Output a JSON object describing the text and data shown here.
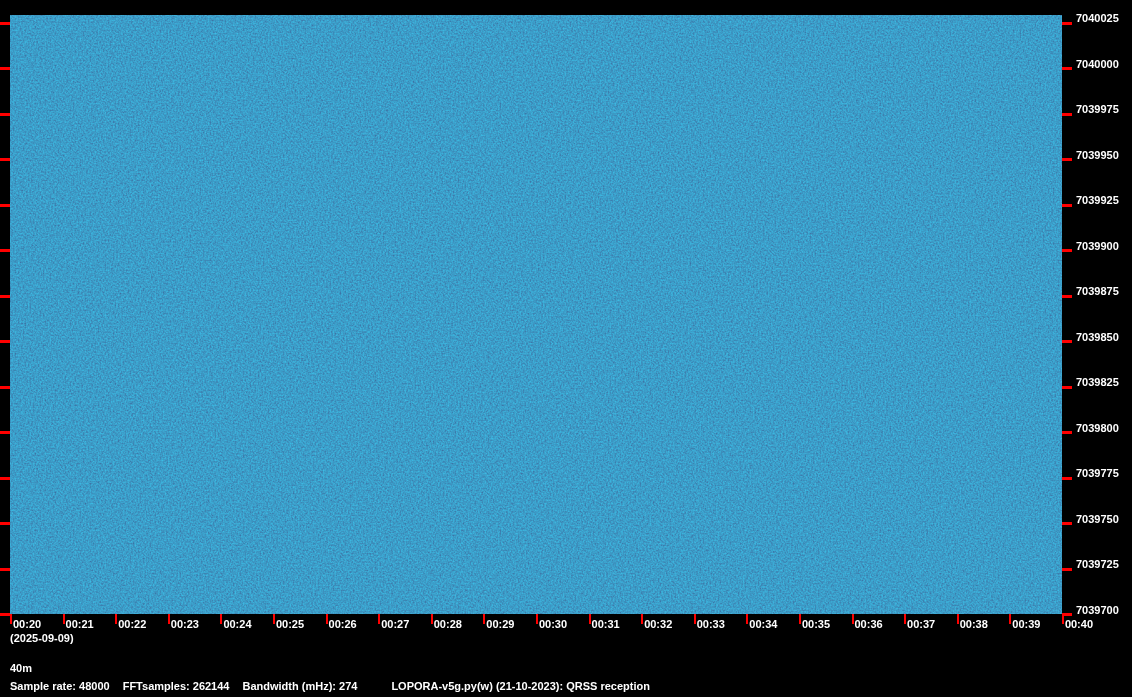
{
  "frequency_ticks": [
    "7040025",
    "7040000",
    "7039975",
    "7039950",
    "7039925",
    "7039900",
    "7039875",
    "7039850",
    "7039825",
    "7039800",
    "7039775",
    "7039750",
    "7039725",
    "7039700"
  ],
  "time_ticks": [
    "00:20",
    "00:21",
    "00:22",
    "00:23",
    "00:24",
    "00:25",
    "00:26",
    "00:27",
    "00:28",
    "00:29",
    "00:30",
    "00:31",
    "00:32",
    "00:33",
    "00:34",
    "00:35",
    "00:36",
    "00:37",
    "00:38",
    "00:39",
    "00:40"
  ],
  "date": "(2025-09-09)",
  "band": "40m",
  "footer": [
    "Sample rate: 48000",
    "FFTsamples: 262144",
    "Bandwidth (mHz): 274",
    "LOPORA-v5g.py(w) (21-10-2023): QRSS reception"
  ]
}
